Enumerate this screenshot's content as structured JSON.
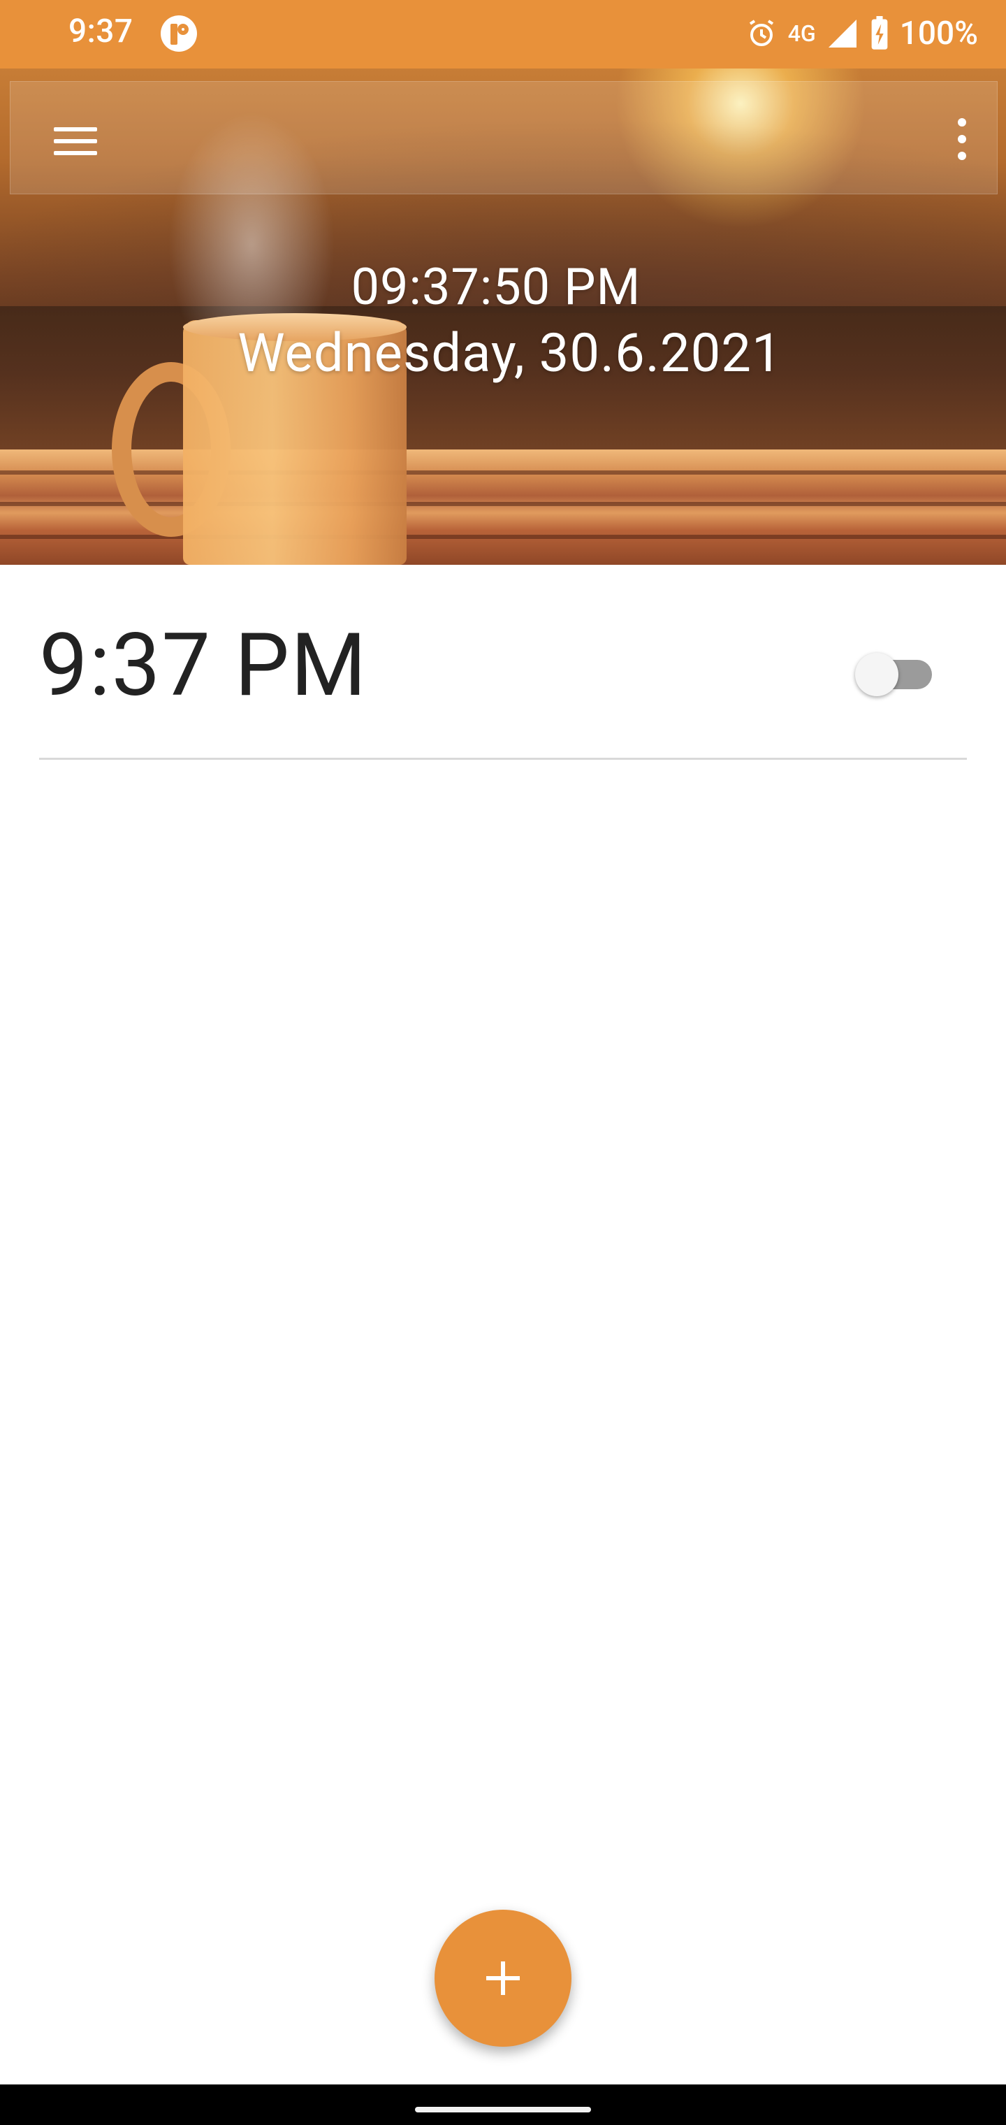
{
  "status_bar": {
    "time": "9:37",
    "network": "4G",
    "battery": "100%"
  },
  "header": {
    "current_time": "09:37:50 PM",
    "current_date": "Wednesday, 30.6.2021"
  },
  "alarms": [
    {
      "time": "9:37 PM",
      "enabled": false
    }
  ],
  "colors": {
    "accent": "#E8913A"
  },
  "icons": {
    "menu": "hamburger-menu-icon",
    "more": "more-vert-icon",
    "add": "plus-icon"
  }
}
